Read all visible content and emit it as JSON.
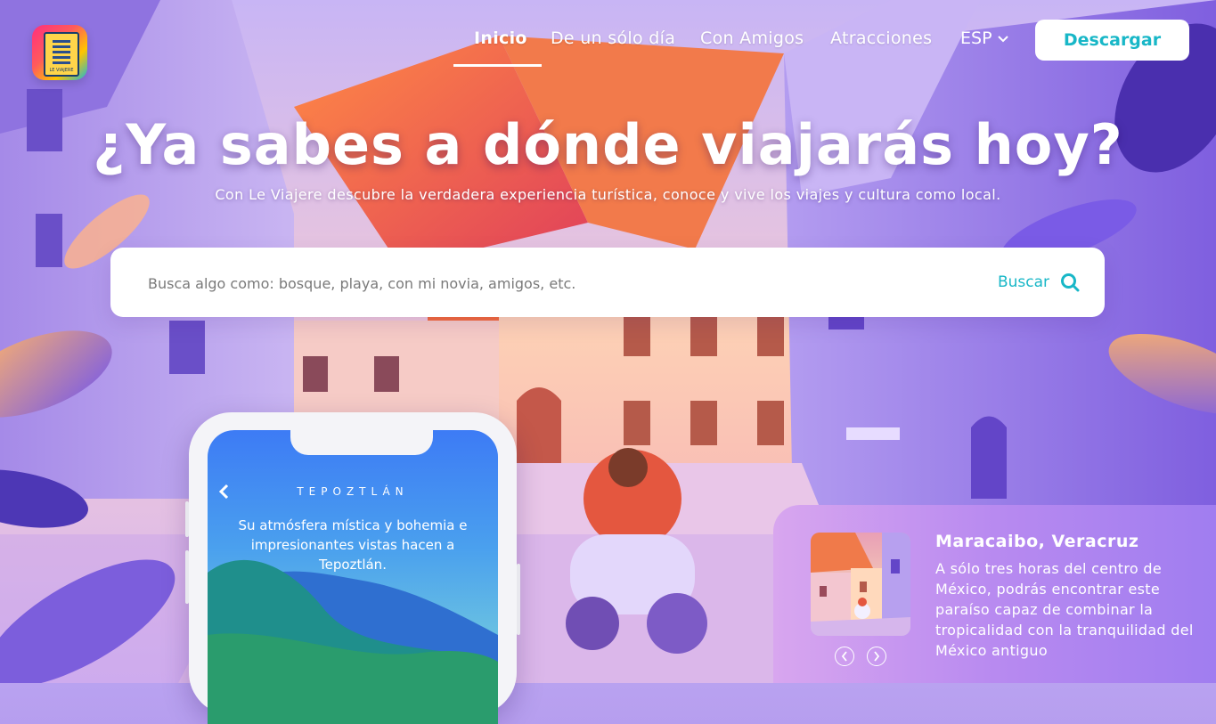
{
  "brand": {
    "logo_text": "LE VIAJERE"
  },
  "nav": {
    "items": [
      {
        "label": "Inicio",
        "active": true
      },
      {
        "label": "De un sólo día"
      },
      {
        "label": "Con Amigos"
      },
      {
        "label": "Atracciones"
      }
    ],
    "language": "ESP",
    "download_label": "Descargar"
  },
  "hero": {
    "title": "¿Ya sabes a dónde viajarás hoy?",
    "subtitle": "Con Le Viajere descubre la verdadera experiencia turística, conoce y vive los viajes y cultura como local."
  },
  "search": {
    "placeholder": "Busca algo como: bosque, playa, con mi novia, amigos, etc.",
    "button_label": "Buscar"
  },
  "phone": {
    "title": "TEPOZTLÁN",
    "description": "Su atmósfera mística y bohemia e impresionantes vistas hacen a Tepoztlán."
  },
  "featured": {
    "title": "Maracaibo, Veracruz",
    "description": "A sólo tres horas del centro de México, podrás encontrar este paraíso capaz de combinar la tropicalidad con la tranquilidad del México antiguo"
  },
  "colors": {
    "accent": "#18b7c7",
    "white": "#ffffff",
    "card_gradient_start": "#d8a6ef",
    "card_gradient_end": "#a07df0"
  },
  "icons": {
    "search": "search-icon",
    "dropdown": "chevron-down-icon",
    "back": "chevron-left-icon",
    "prev": "arrow-left-icon",
    "next": "arrow-right-icon"
  }
}
